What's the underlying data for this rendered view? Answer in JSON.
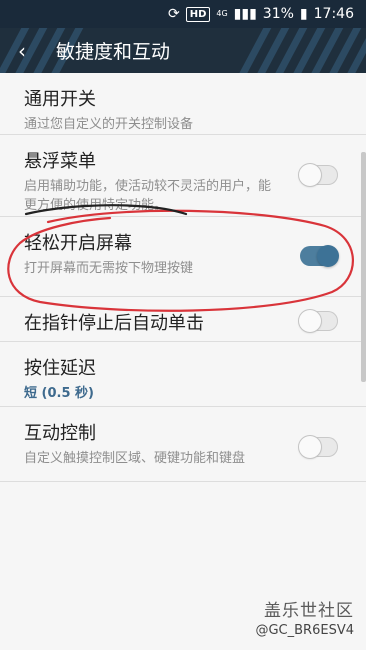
{
  "status_bar": {
    "hd": "HD",
    "network": "4G",
    "battery": "31%",
    "time": "17:46"
  },
  "header": {
    "back_icon": "back-arrow-icon",
    "title": "敏捷度和互动"
  },
  "settings": [
    {
      "label": "通用开关",
      "sub": "通过您自定义的开关控制设备",
      "toggle": null
    },
    {
      "label": "悬浮菜单",
      "sub": "启用辅助功能，使活动较不灵活的用户，能更方便的使用特定功能。",
      "toggle": false
    },
    {
      "label": "轻松开启屏幕",
      "sub": "打开屏幕而无需按下物理按键",
      "toggle": true
    },
    {
      "label": "在指针停止后自动单击",
      "sub": "",
      "toggle": false
    },
    {
      "label": "按住延迟",
      "sub": "短 (0.5 秒)",
      "toggle": null
    },
    {
      "label": "互动控制",
      "sub": "自定义触摸控制区域、硬键功能和键盘",
      "toggle": false
    }
  ],
  "watermark": {
    "brand": "盖乐世社区",
    "user": "@GC_BR6ESV4"
  },
  "colors": {
    "app_bar": "#1f2f3d",
    "accent": "#3d7296",
    "annotation": "#d9343a"
  }
}
